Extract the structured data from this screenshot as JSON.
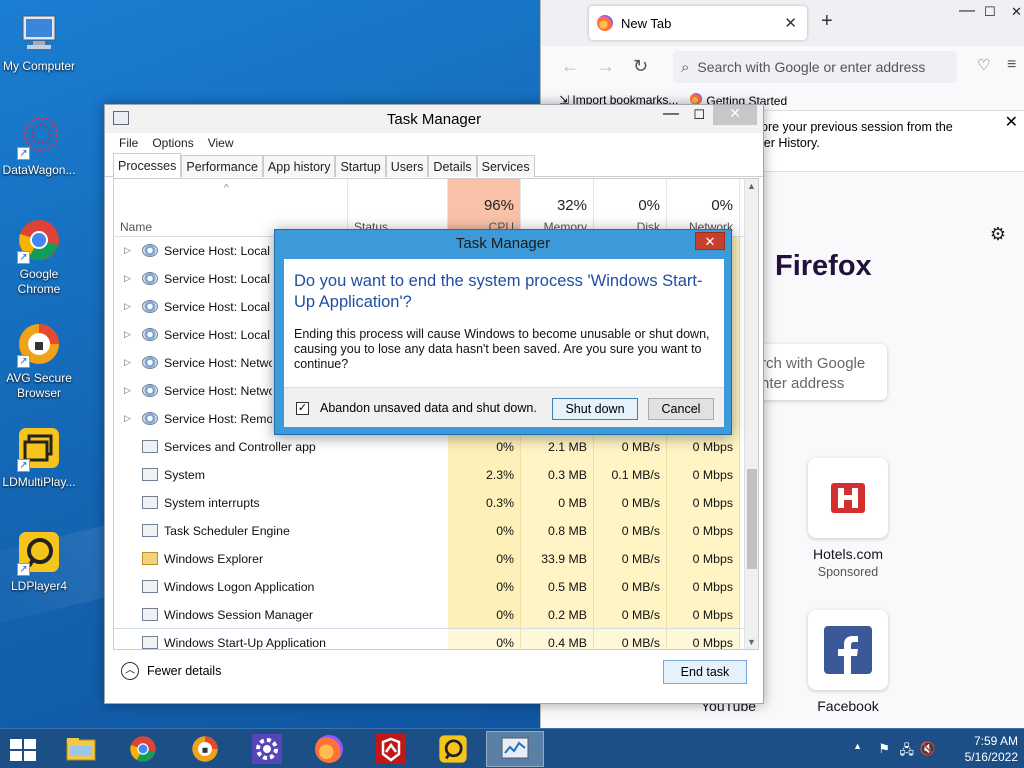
{
  "desktop": {
    "icons": [
      {
        "label": "My Computer",
        "name": "my-computer-icon"
      },
      {
        "label": "DataWagon...",
        "name": "datawagon-icon"
      },
      {
        "label": "Google Chrome",
        "name": "chrome-desktop-icon"
      },
      {
        "label": "AVG Secure Browser",
        "name": "avg-browser-icon"
      },
      {
        "label": "LDMultiPlay...",
        "name": "ldmultiplayer-icon"
      },
      {
        "label": "LDPlayer4",
        "name": "ldplayer4-icon"
      }
    ]
  },
  "firefox": {
    "tab_title": "New Tab",
    "tab_close": "✕",
    "new_tab": "+",
    "url_placeholder": "Search with Google or enter address",
    "bookmarks": [
      "Import bookmarks...",
      "Getting Started"
    ],
    "notice_line1": "ore your previous session from the",
    "notice_line2": "ler History.",
    "logo_text": "Firefox",
    "search_text_line1": "rch with Google",
    "search_text_line2": "nter address",
    "tiles": [
      {
        "label": "Hotels.com",
        "sponsor": "Sponsored",
        "icon": "hotels-icon"
      },
      {
        "label": "Facebook",
        "sponsor": "",
        "icon": "facebook-icon"
      }
    ],
    "partial_tile": "YouTube"
  },
  "taskmgr": {
    "title": "Task Manager",
    "menu": [
      "File",
      "Options",
      "View"
    ],
    "tabs": [
      "Processes",
      "Performance",
      "App history",
      "Startup",
      "Users",
      "Details",
      "Services"
    ],
    "active_tab": "Processes",
    "columns": {
      "name": "Name",
      "status": "Status",
      "cpu_pct": "96%",
      "cpu": "CPU",
      "mem_pct": "32%",
      "mem": "Memory",
      "disk_pct": "0%",
      "disk": "Disk",
      "net_pct": "0%",
      "net": "Network"
    },
    "rows": [
      {
        "name": "Service Host: Local Se",
        "cpu": "",
        "mem": "",
        "disk": "",
        "net": "",
        "expand": "▷",
        "icon": "gear"
      },
      {
        "name": "Service Host: Local Se",
        "cpu": "",
        "mem": "",
        "disk": "",
        "net": "",
        "expand": "▷",
        "icon": "gear"
      },
      {
        "name": "Service Host: Local Sy",
        "cpu": "",
        "mem": "",
        "disk": "",
        "net": "",
        "expand": "▷",
        "icon": "gear"
      },
      {
        "name": "Service Host: Local Sy",
        "cpu": "",
        "mem": "",
        "disk": "",
        "net": "",
        "expand": "▷",
        "icon": "gear"
      },
      {
        "name": "Service Host: Networ",
        "cpu": "",
        "mem": "",
        "disk": "",
        "net": "",
        "expand": "▷",
        "icon": "gear"
      },
      {
        "name": "Service Host: Networ",
        "cpu": "",
        "mem": "",
        "disk": "",
        "net": "",
        "expand": "▷",
        "icon": "gear"
      },
      {
        "name": "Service Host: Remote",
        "cpu": "",
        "mem": "",
        "disk": "",
        "net": "",
        "expand": "▷",
        "icon": "gear"
      },
      {
        "name": "Services and Controller app",
        "cpu": "0%",
        "mem": "2.1 MB",
        "disk": "0 MB/s",
        "net": "0 Mbps",
        "expand": "",
        "icon": "app"
      },
      {
        "name": "System",
        "cpu": "2.3%",
        "mem": "0.3 MB",
        "disk": "0.1 MB/s",
        "net": "0 Mbps",
        "expand": "",
        "icon": "app"
      },
      {
        "name": "System interrupts",
        "cpu": "0.3%",
        "mem": "0 MB",
        "disk": "0 MB/s",
        "net": "0 Mbps",
        "expand": "",
        "icon": "app"
      },
      {
        "name": "Task Scheduler Engine",
        "cpu": "0%",
        "mem": "0.8 MB",
        "disk": "0 MB/s",
        "net": "0 Mbps",
        "expand": "",
        "icon": "app"
      },
      {
        "name": "Windows Explorer",
        "cpu": "0%",
        "mem": "33.9 MB",
        "disk": "0 MB/s",
        "net": "0 Mbps",
        "expand": "",
        "icon": "folder"
      },
      {
        "name": "Windows Logon Application",
        "cpu": "0%",
        "mem": "0.5 MB",
        "disk": "0 MB/s",
        "net": "0 Mbps",
        "expand": "",
        "icon": "app"
      },
      {
        "name": "Windows Session Manager",
        "cpu": "0%",
        "mem": "0.2 MB",
        "disk": "0 MB/s",
        "net": "0 Mbps",
        "expand": "",
        "icon": "app"
      },
      {
        "name": "Windows Start-Up Application",
        "cpu": "0%",
        "mem": "0.4 MB",
        "disk": "0 MB/s",
        "net": "0 Mbps",
        "expand": "",
        "icon": "app",
        "selected": true
      }
    ],
    "fewer_details": "Fewer details",
    "end_task": "End task"
  },
  "dialog": {
    "title": "Task Manager",
    "close": "✕",
    "main": "Do you want to end the system process 'Windows Start-Up Application'?",
    "sub": "Ending this process will cause Windows to become unusable or shut down, causing you to lose any data hasn't been saved. Are you sure you want to continue?",
    "checkbox_label": "Abandon unsaved data and shut down.",
    "checked": true,
    "shutdown_label": "Shut down",
    "cancel_label": "Cancel"
  },
  "taskbar": {
    "apps": [
      "file-explorer",
      "chrome",
      "avg-browser",
      "settings",
      "firefox",
      "mcafee",
      "ldplayer",
      "task-manager"
    ],
    "active": "task-manager",
    "time": "7:59 AM",
    "date": "5/16/2022"
  },
  "colors": {
    "desktop": "#1466b4",
    "dialog_border": "#3c9ad8",
    "cpu_header": "#f9c2a8",
    "heat": "#fff4c4",
    "taskbar": "#1c4f86"
  }
}
